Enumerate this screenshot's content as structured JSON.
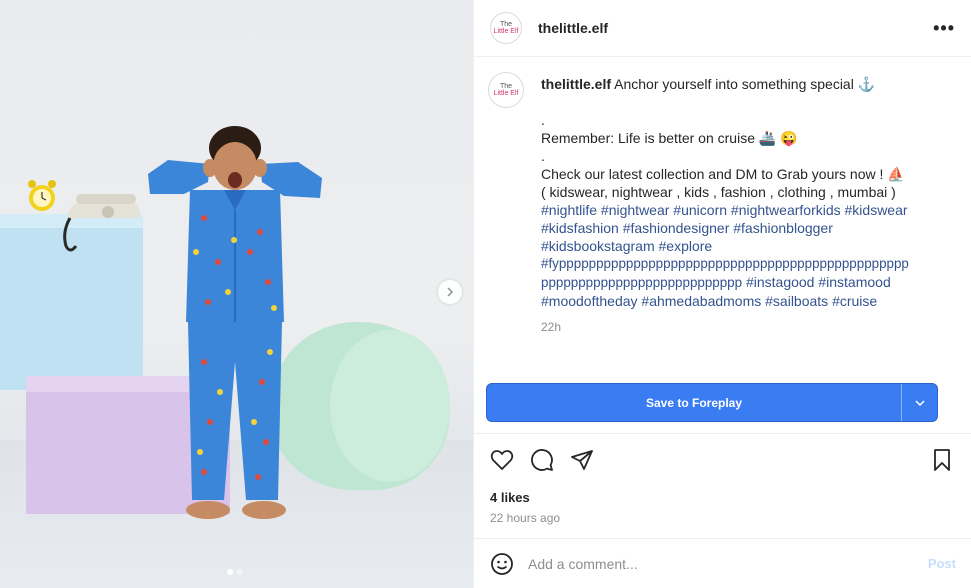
{
  "post": {
    "username": "thelittle.elf",
    "avatar_text_line1": "The",
    "avatar_text_line2": "Little Elf",
    "more_glyph": "•••",
    "caption": {
      "line1": "Anchor yourself into something special ⚓",
      "line2": ".",
      "line3": "Remember: Life is better on cruise 🚢 😜",
      "line4": ".",
      "line5": "Check our latest collection and DM to Grab yours now ! ⛵",
      "line6": "( kidswear, nightwear , kids , fashion , clothing , mumbai )",
      "tags_line1": "#nightlife #nightwear #unicorn #nightwearforkids #kidswear",
      "tags_line2": "#kidsfashion #fashiondesigner #fashionblogger",
      "tags_line3": "#kidsbookstagram #explore",
      "tags_line4": "#fyppppppppppppppppppppppppppppppppppppppppppppppp",
      "tags_line5a": "ppppppppppppppppppppppppppp",
      "tags_line5b": "#instagood #instamood",
      "tags_line6": "#moodoftheday #ahmedabadmoms #sailboats #cruise",
      "age": "22h"
    },
    "save_button_label": "Save to Foreplay",
    "likes_text": "4 likes",
    "time_text": "22 hours ago",
    "comment_placeholder": "Add a comment...",
    "post_button_label": "Post"
  },
  "colors": {
    "accent": "#3a7cf2",
    "hashtag": "#34538e",
    "muted": "#8e8e8e",
    "post_disabled": "#c7dffa"
  },
  "carousel": {
    "current": 1,
    "total": 2
  }
}
